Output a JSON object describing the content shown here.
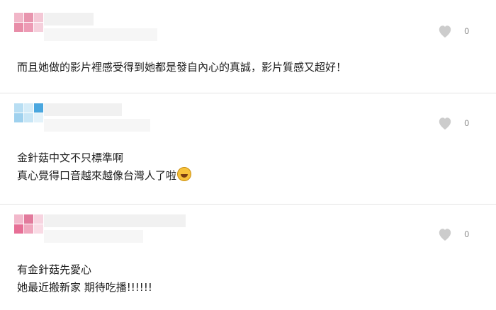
{
  "comments": [
    {
      "avatar_colors": [
        "#f1b6c8",
        "#e895ae",
        "#f4c8d6",
        "#e88da8",
        "#ed9bb5",
        "#f5d0dc"
      ],
      "like_icon": "heart-icon",
      "like_count": "0",
      "lines": [
        "而且她做的影片裡感受得到她都是發自內心的真誠，影片質感又超好！"
      ]
    },
    {
      "avatar_colors": [
        "#b8def3",
        "#d5ecf8",
        "#4aa7df",
        "#9fd1ee",
        "#c8e6f6",
        "#e3f2fa"
      ],
      "like_icon": "heart-icon",
      "like_count": "0",
      "lines": [
        "金針菇中文不只標準啊",
        "真心覺得口音越來越像台灣人了啦"
      ],
      "emoji": "laughing-emoji"
    },
    {
      "avatar_colors": [
        "#f2b8cb",
        "#e27a9c",
        "#f7d4e0",
        "#e76f96",
        "#f0a7be",
        "#f9dbe5"
      ],
      "like_icon": "heart-icon",
      "like_count": "0",
      "lines": [
        "有金針菇先愛心",
        "她最近搬新家 期待吃播!!!!!!"
      ]
    }
  ]
}
